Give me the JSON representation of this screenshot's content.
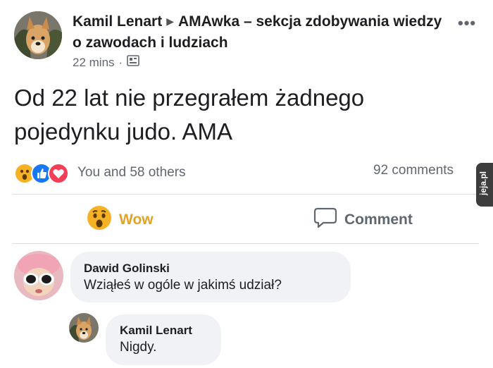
{
  "header": {
    "author": "Kamil Lenart",
    "group": "AMAwka – sekcja zdobywania wiedzy o zawodach i ludziach",
    "time": "22 mins",
    "separator": "·",
    "more_label": "•••"
  },
  "post": {
    "text": "Od 22 lat nie przegrałem żadnego pojedynku judo. AMA"
  },
  "reactions": {
    "summary": "You and 58 others",
    "comments_count": "92 comments"
  },
  "actions": {
    "wow_label": "Wow",
    "comment_label": "Comment"
  },
  "comments": [
    {
      "author": "Dawid Golinski",
      "text": "Wziąłeś w ogóle w jakimś udział?"
    },
    {
      "author": "Kamil Lenart",
      "text": "Nigdy."
    }
  ],
  "watermark": "jeja.pl",
  "colors": {
    "wow": "#f7b125",
    "like": "#1877f2",
    "love": "#f33e58",
    "secondary_text": "#606770",
    "bubble": "#f0f2f5"
  }
}
